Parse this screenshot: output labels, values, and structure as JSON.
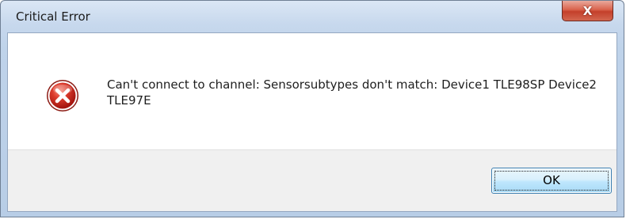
{
  "window": {
    "title": "Critical Error",
    "close_icon": "close-icon",
    "close_glyph": "X"
  },
  "message": {
    "icon": "error-icon",
    "text": "Can't connect to channel: Sensorsubtypes don't match: Device1 TLE98SP Device2 TLE97E"
  },
  "buttons": {
    "ok_label": "OK"
  },
  "colors": {
    "close_button": "#c4402b",
    "error_icon": "#c8231d",
    "ok_button_border": "#3c7fb1"
  }
}
